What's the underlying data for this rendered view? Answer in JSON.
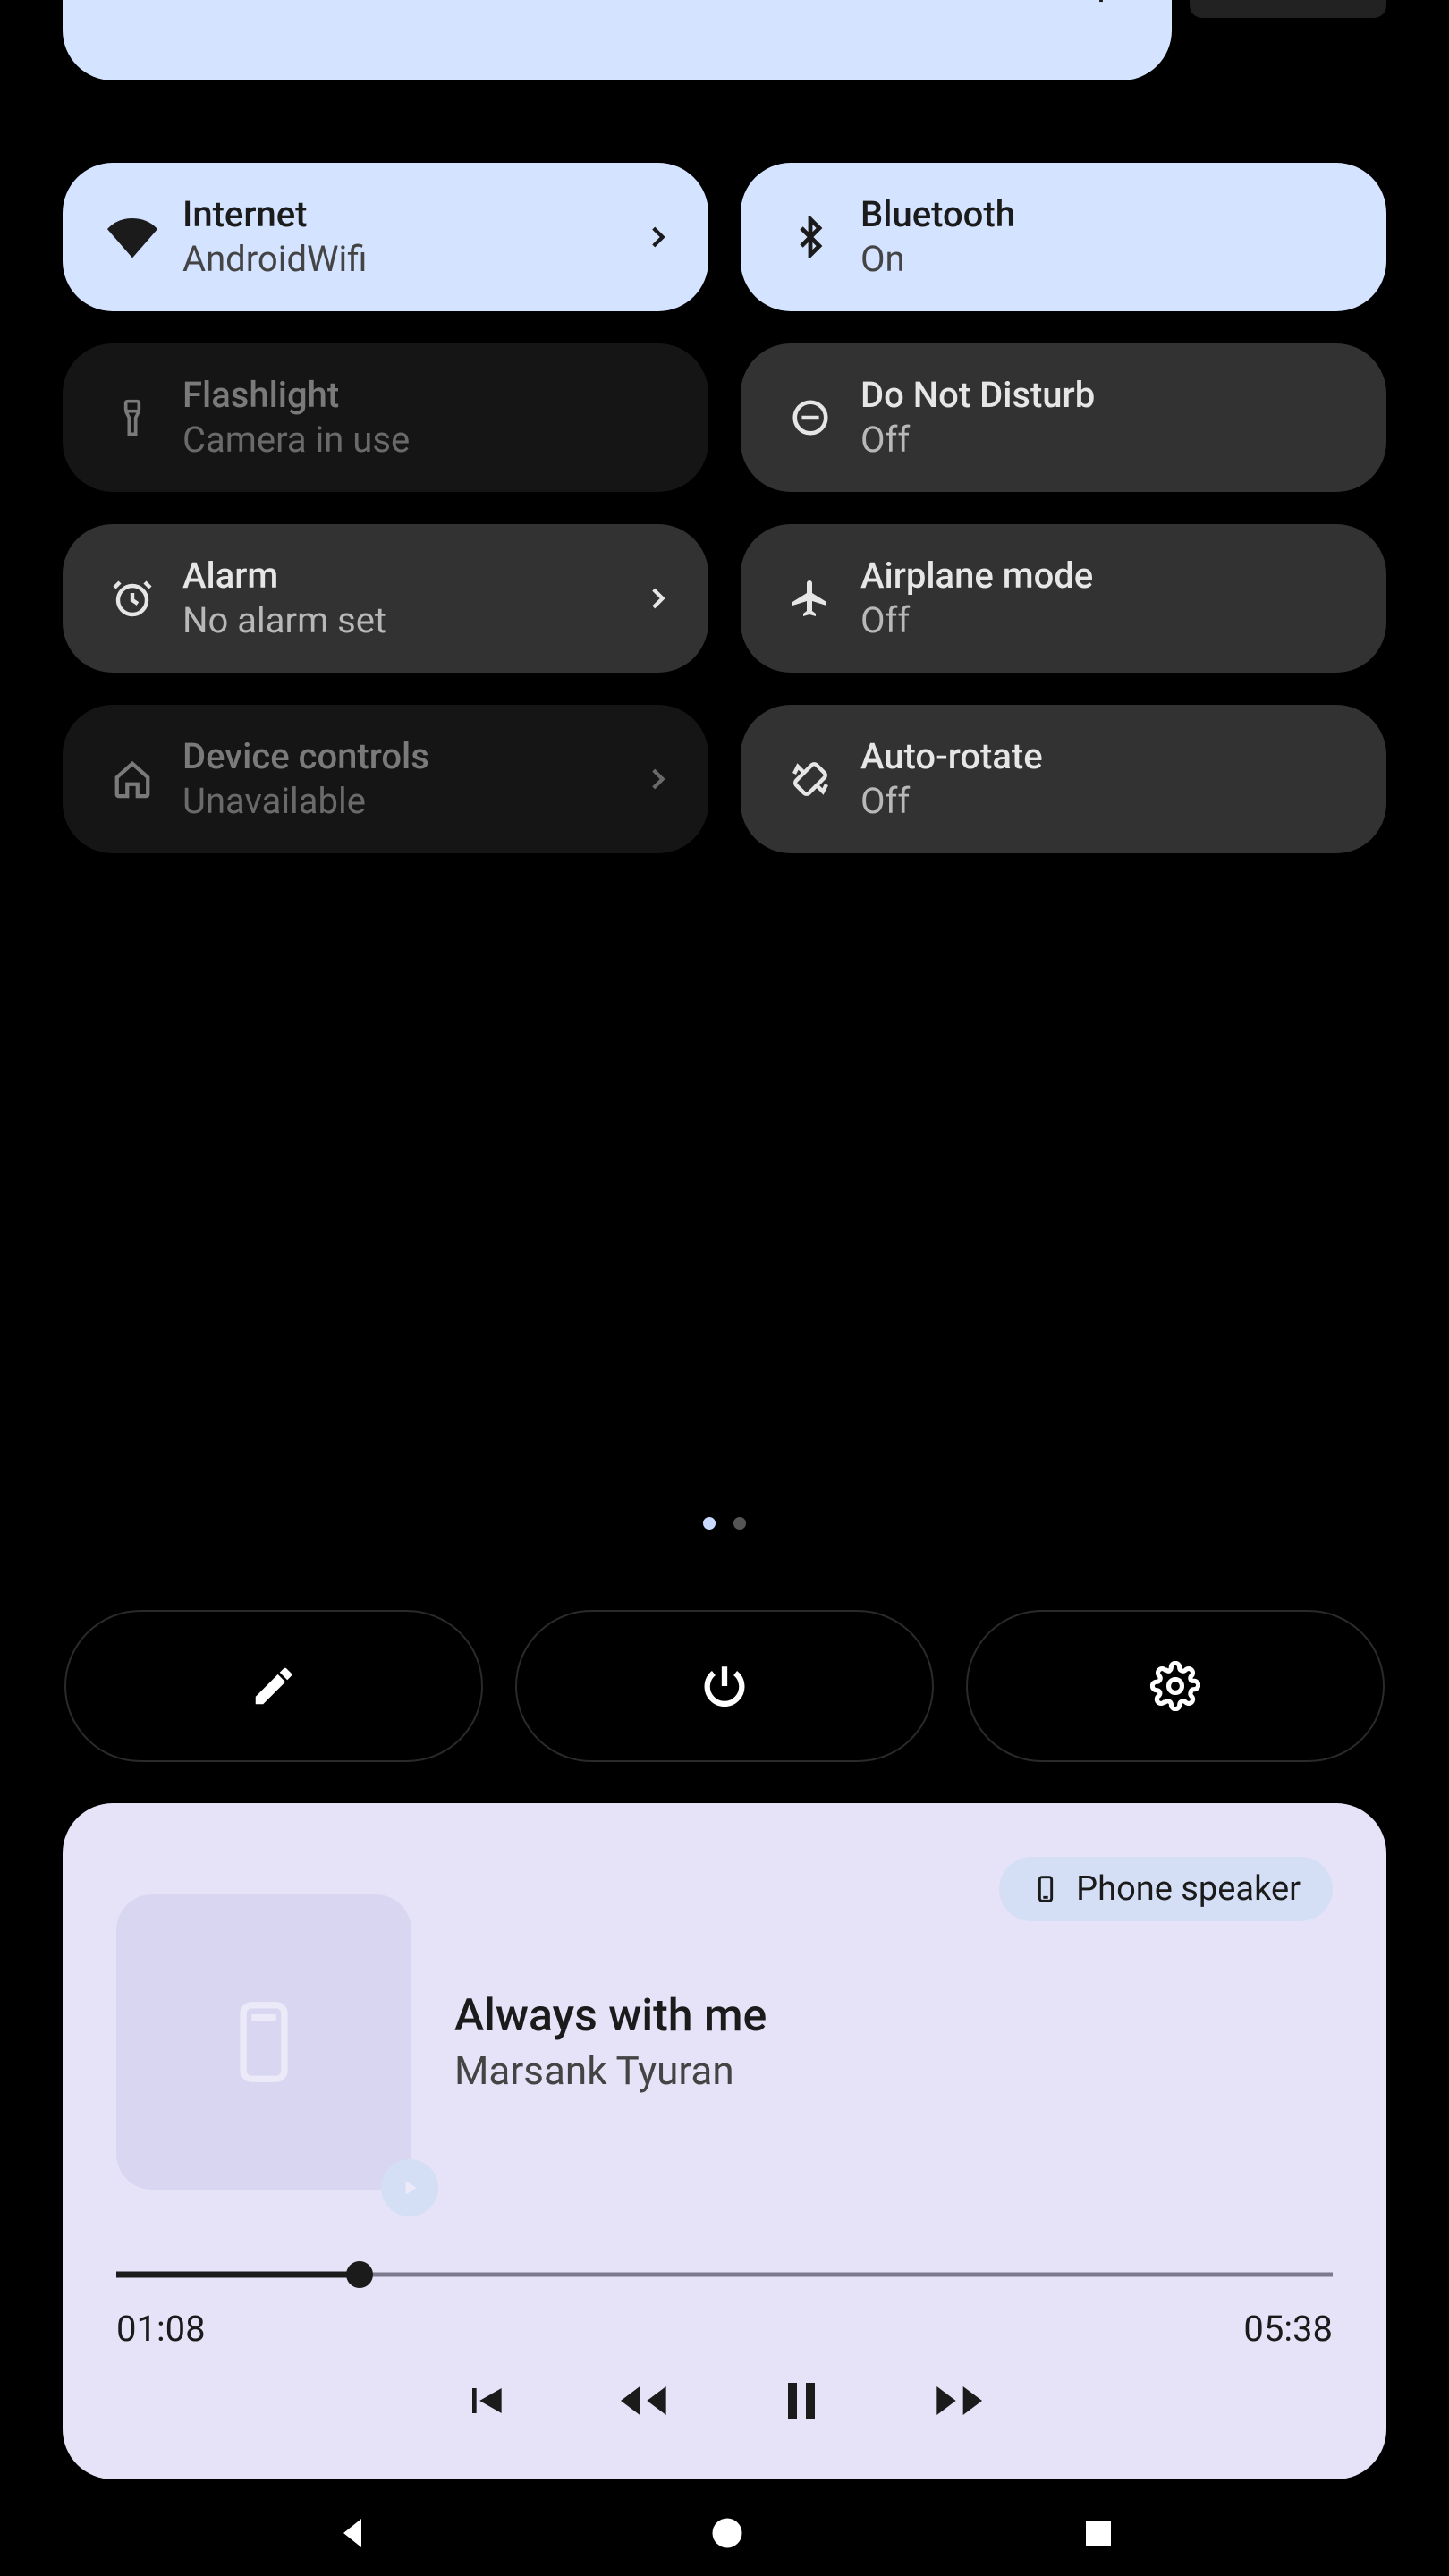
{
  "brightness": {
    "icon": "brightness"
  },
  "tiles": [
    {
      "key": "internet",
      "title": "Internet",
      "subtitle": "AndroidWifi",
      "state": "active",
      "icon": "wifi",
      "chevron": true
    },
    {
      "key": "bluetooth",
      "title": "Bluetooth",
      "subtitle": "On",
      "state": "active",
      "icon": "bluetooth",
      "chevron": false
    },
    {
      "key": "flashlight",
      "title": "Flashlight",
      "subtitle": "Camera in use",
      "state": "disabled",
      "icon": "flashlight",
      "chevron": false
    },
    {
      "key": "dnd",
      "title": "Do Not Disturb",
      "subtitle": "Off",
      "state": "inactive",
      "icon": "dnd",
      "chevron": false
    },
    {
      "key": "alarm",
      "title": "Alarm",
      "subtitle": "No alarm set",
      "state": "inactive",
      "icon": "alarm",
      "chevron": true
    },
    {
      "key": "airplane",
      "title": "Airplane mode",
      "subtitle": "Off",
      "state": "inactive",
      "icon": "airplane",
      "chevron": false
    },
    {
      "key": "device",
      "title": "Device controls",
      "subtitle": "Unavailable",
      "state": "disabled",
      "icon": "home",
      "chevron": true
    },
    {
      "key": "rotate",
      "title": "Auto-rotate",
      "subtitle": "Off",
      "state": "inactive",
      "icon": "rotate",
      "chevron": false
    }
  ],
  "pager": {
    "count": 2,
    "active": 0
  },
  "footer": {
    "edit": "edit",
    "power": "power",
    "settings": "settings"
  },
  "media": {
    "output_label": "Phone speaker",
    "track_title": "Always with me",
    "artist": "Marsank Tyuran",
    "elapsed": "01:08",
    "duration": "05:38",
    "progress_pct": 20
  }
}
